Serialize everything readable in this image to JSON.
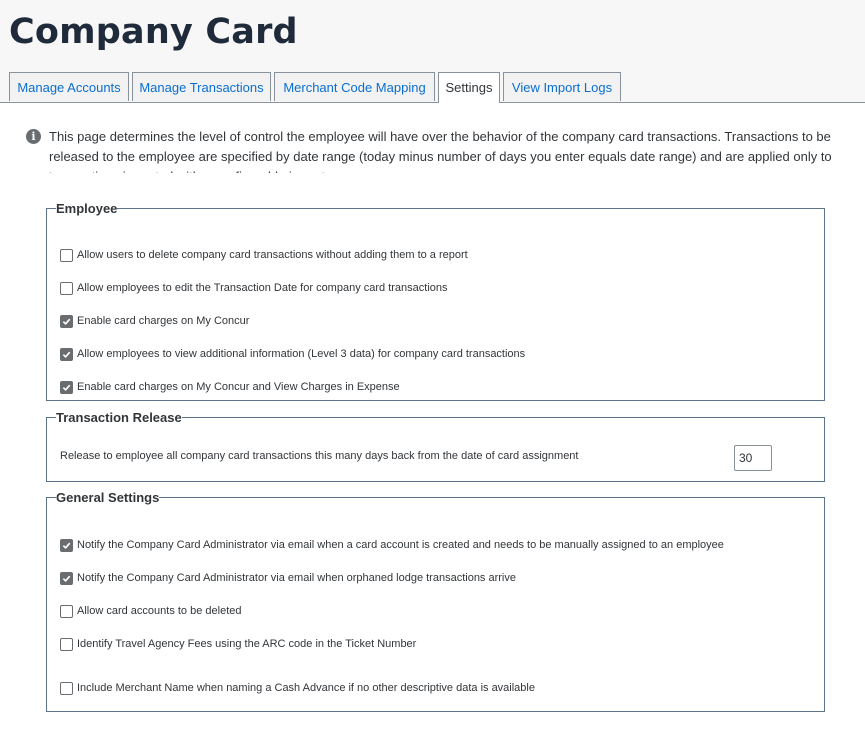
{
  "page": {
    "title": "Company Card"
  },
  "tabs": [
    {
      "label": "Manage Accounts",
      "active": false
    },
    {
      "label": "Manage Transactions",
      "active": false
    },
    {
      "label": "Merchant Code Mapping",
      "active": false
    },
    {
      "label": "Settings",
      "active": true
    },
    {
      "label": "View Import Logs",
      "active": false
    }
  ],
  "info": {
    "icon": "info-icon",
    "text": "This page determines the level of control the employee will have over the behavior of the company card transactions. Transactions to be released to the employee are specified by date range (today minus number of days you enter equals date range) and are applied only to transactions imported with a configurable importer."
  },
  "employee": {
    "legend": "Employee",
    "options": [
      {
        "label": "Allow users to delete company card transactions without adding them to a report",
        "checked": false
      },
      {
        "label": "Allow employees to edit the Transaction Date for company card transactions",
        "checked": false
      },
      {
        "label": "Enable card charges on My Concur",
        "checked": true
      },
      {
        "label": "Allow employees to view additional information (Level 3 data) for company card transactions",
        "checked": true
      },
      {
        "label": "Enable card charges on My Concur and View Charges in Expense",
        "checked": true
      }
    ]
  },
  "transaction_release": {
    "legend": "Transaction Release",
    "label": "Release to employee all company card transactions this many days back from the date of card assignment",
    "days_value": "30"
  },
  "general": {
    "legend": "General Settings",
    "options": [
      {
        "label": "Notify the Company Card Administrator via email when a card account is created and needs to be manually assigned to an employee",
        "checked": true
      },
      {
        "label": "Notify the Company Card Administrator via email when orphaned lodge transactions arrive",
        "checked": true
      },
      {
        "label": "Allow card accounts to be deleted",
        "checked": false
      },
      {
        "label": "Identify Travel Agency Fees using the ARC code in the Ticket Number",
        "checked": false
      },
      {
        "label": "Include Merchant Name when naming a Cash Advance if no other descriptive data is available",
        "checked": false
      }
    ]
  },
  "colors": {
    "link": "#0a6ed1",
    "border": "#5b738b",
    "checked_fill": "#6a6d70",
    "title": "#1f2b3a"
  }
}
